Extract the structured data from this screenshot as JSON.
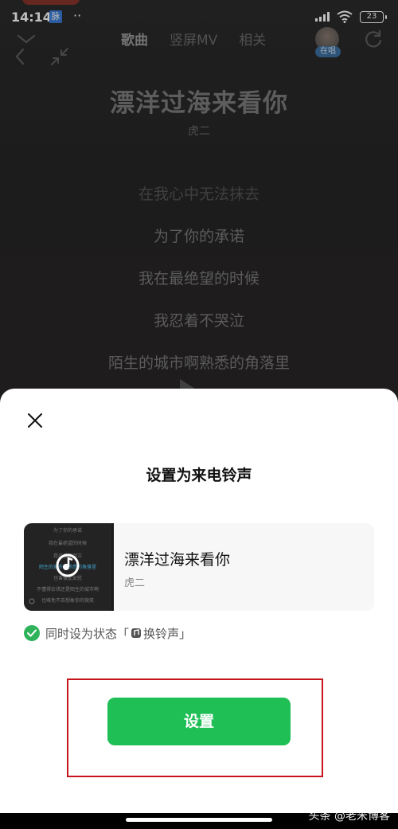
{
  "status_bar": {
    "time": "14:14",
    "badge": "脉",
    "dots": "··",
    "battery": "23"
  },
  "player": {
    "tabs": [
      "歌曲",
      "竖屏MV",
      "相关"
    ],
    "avatar_tag": "在唱",
    "song_title": "漂洋过海来看你",
    "song_artist": "虎二",
    "lyrics": [
      "在我心中无法抹去",
      "为了你的承诺",
      "我在最绝望的时候",
      "我忍着不哭泣",
      "陌生的城市啊熟悉的角落里"
    ],
    "thumb_lyrics": [
      "为了你的承诺",
      "我在最绝望的时候",
      "我忍着不哭泣",
      "陌生的城市啊熟悉的角落里",
      "也曾彼此安慰",
      "不懂得珍惜还是陌生的城市啊",
      "也难免不去想象你的微笑"
    ]
  },
  "sheet": {
    "title": "设置为来电铃声",
    "card_title": "漂洋过海来看你",
    "card_artist": "虎二",
    "checkbox_before": "同时设为状态「",
    "checkbox_after": "换铃声」",
    "checkbox_checked": true,
    "set_button": "设置"
  },
  "watermark": "头条 @老米博客",
  "colors": {
    "accent": "#1fbf56",
    "check": "#2fb35a",
    "highlight": "#c8141c"
  }
}
